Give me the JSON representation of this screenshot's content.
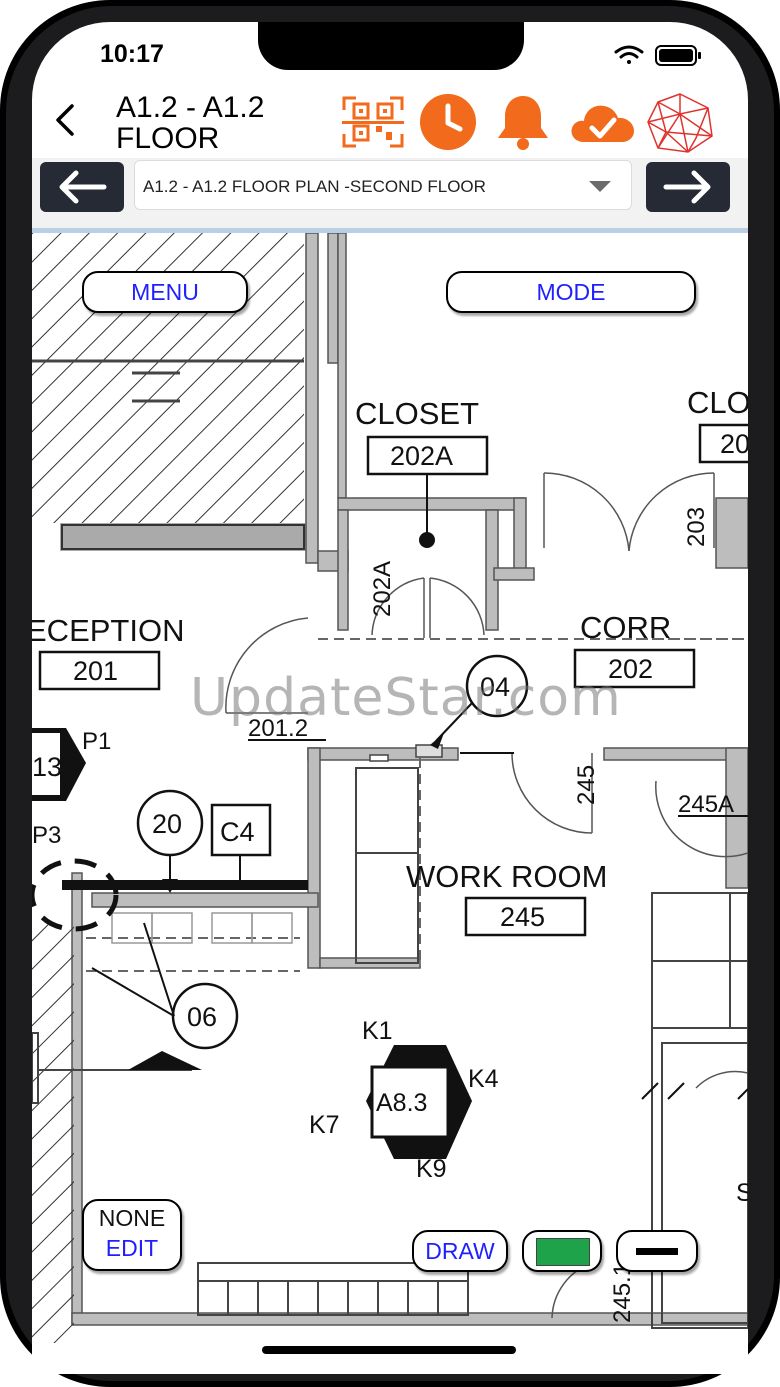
{
  "status_bar": {
    "time": "10:17"
  },
  "header": {
    "title": "A1.2 - A1.2 FLOOR"
  },
  "plan_selector": {
    "selected": "A1.2 - A1.2 FLOOR PLAN -SECOND FLOOR"
  },
  "overlay_buttons": {
    "menu": "MENU",
    "mode": "MODE",
    "none": "NONE",
    "edit": "EDIT",
    "draw": "DRAW"
  },
  "watermark": "UpdateStar.com",
  "colors": {
    "accent": "#f26a1b",
    "nav_dark": "#252a35",
    "button_text": "#1f1fff",
    "fill_swatch": "#1fa34a"
  },
  "icons": [
    "chevron-left-icon",
    "qr-code-icon",
    "clock-icon",
    "bell-icon",
    "cloud-check-icon",
    "polyhedron-icon",
    "arrow-left-icon",
    "arrow-right-icon",
    "caret-down-icon"
  ],
  "floor_plan": {
    "rooms": [
      {
        "name": "CLOSET",
        "number": "202A"
      },
      {
        "name": "CLO",
        "number": "20"
      },
      {
        "name": "ECEPTION",
        "number": "201"
      },
      {
        "name": "CORR",
        "number": "202"
      },
      {
        "name": "WORK ROOM",
        "number": "245"
      }
    ],
    "labels": [
      "202A",
      "203",
      "201.2",
      "245",
      "245A",
      "245.1",
      "P1",
      "P3",
      "13",
      "C4",
      "K1",
      "K4",
      "K7",
      "K9",
      "A8.3",
      "S"
    ],
    "callouts": [
      "04",
      "20",
      "06"
    ]
  }
}
